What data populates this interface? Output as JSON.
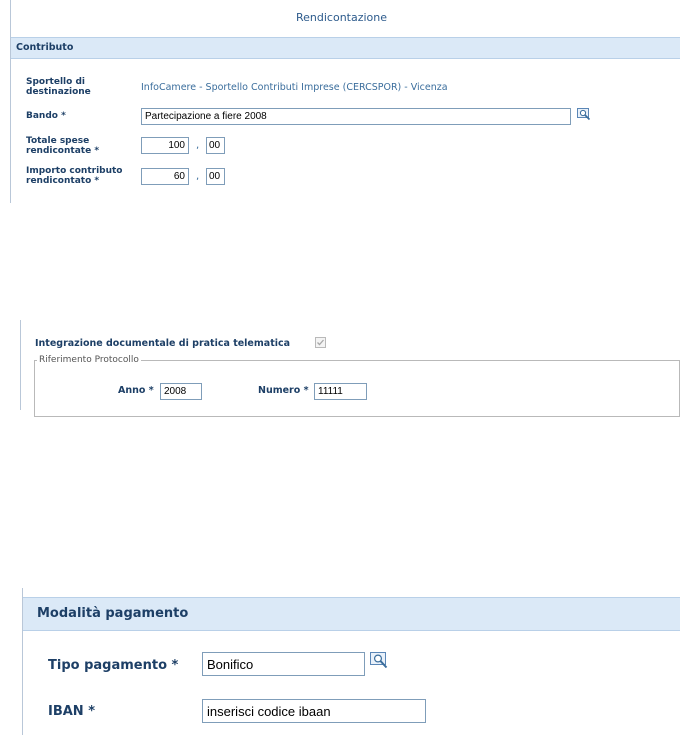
{
  "page_title": "Rendicontazione",
  "contributo": {
    "title": "Contributo",
    "sportello_label": "Sportello di destinazione",
    "sportello_value": "InfoCamere - Sportello Contributi Imprese (CERCSPOR) - Vicenza",
    "bando_label": "Bando *",
    "bando_value": "Partecipazione a fiere 2008",
    "totale_label": "Totale spese rendicontate *",
    "totale_int": "100",
    "totale_dec": "00",
    "importo_label": "Importo contributo rendicontato *",
    "importo_int": "60",
    "importo_dec": "00",
    "decimal_sep": ","
  },
  "integrazione": {
    "label": "Integrazione documentale di pratica telematica",
    "checked": true,
    "fieldset_legend": "Riferimento Protocollo",
    "anno_label": "Anno *",
    "anno_value": "2008",
    "numero_label": "Numero *",
    "numero_value": "11111"
  },
  "pagamento": {
    "title": "Modalità pagamento",
    "tipo_label": "Tipo pagamento *",
    "tipo_value": "Bonifico",
    "iban_label": "IBAN *",
    "iban_value": "inserisci codice ibaan"
  },
  "icons": {
    "lookup": "magnifier-lookup-icon",
    "checkbox": "checkbox-icon"
  },
  "colors": {
    "section_bg": "#dbe9f7",
    "label": "#1d3f66",
    "value": "#3a6d9c"
  }
}
